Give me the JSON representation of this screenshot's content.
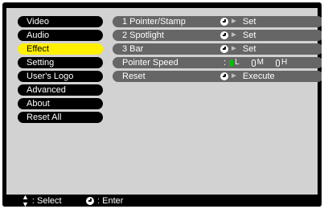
{
  "main_menu": {
    "items": [
      {
        "label": "Video"
      },
      {
        "label": "Audio"
      },
      {
        "label": "Effect"
      },
      {
        "label": "Setting"
      },
      {
        "label": "User's Logo"
      },
      {
        "label": "Advanced"
      },
      {
        "label": "About"
      },
      {
        "label": "Reset All"
      }
    ],
    "selected_label": "Effect"
  },
  "submenu": {
    "rows": [
      {
        "label": "1  Pointer/Stamp",
        "action": "Set"
      },
      {
        "label": "2  Spotlight",
        "action": "Set"
      },
      {
        "label": "3  Bar",
        "action": "Set"
      },
      {
        "label": "Pointer Speed",
        "colon": ":",
        "options": [
          {
            "label": "L",
            "selected": true
          },
          {
            "label": "M",
            "selected": false
          },
          {
            "label": "H",
            "selected": false
          }
        ]
      },
      {
        "label": "Reset",
        "action": "Execute"
      }
    ]
  },
  "footer": {
    "select_label": ": Select",
    "enter_label": ": Enter"
  },
  "colors": {
    "selected_item": "#ffef00",
    "selected_radio": "#00c000",
    "submenu_row": "#666666",
    "background": "#d2d2d2"
  }
}
